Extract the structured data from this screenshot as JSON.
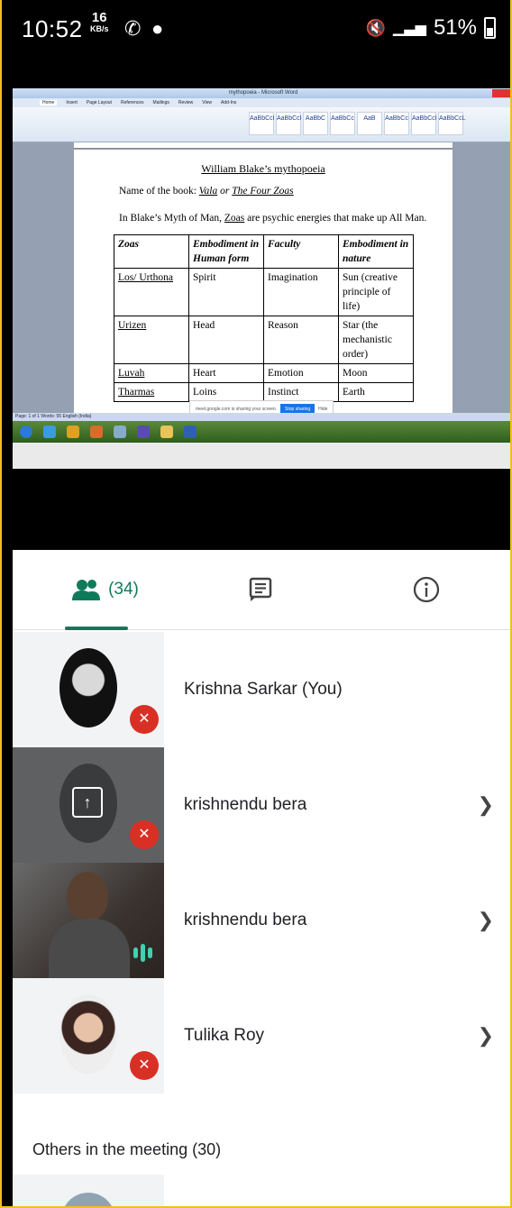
{
  "status": {
    "time": "10:52",
    "kbs_value": "16",
    "kbs_unit": "KB/s",
    "battery": "51%"
  },
  "word": {
    "window_title": "mythopoeia - Microsoft Word",
    "menus": [
      "Home",
      "Insert",
      "Page Layout",
      "References",
      "Mailings",
      "Review",
      "View",
      "Add-Ins"
    ],
    "styles": [
      "AaBbCcI",
      "AaBbCcI",
      "AaBbC",
      "AaBbCc",
      "AaB",
      "AaBbCc",
      "AaBbCcI",
      "AaBbCcL"
    ],
    "doc_title": "William Blake’s mythopoeia",
    "book_line_prefix": "Name of the book: ",
    "book_title_a": "Vala",
    "book_title_or": " or ",
    "book_title_b": "The Four Zoas",
    "myth_line_a": "In Blake’s Myth of Man, ",
    "myth_line_zoas": "Zoas",
    "myth_line_b": " are psychic energies that make up All Man.",
    "table": {
      "headers": [
        "Zoas",
        "Embodiment in Human form",
        "Faculty",
        "Embodiment in nature"
      ],
      "rows": [
        [
          "Los/ Urthona",
          "Spirit",
          "Imagination",
          "Sun (creative principle of life)"
        ],
        [
          "Urizen",
          "Head",
          "Reason",
          "Star (the mechanistic order)"
        ],
        [
          "Luvah",
          "Heart",
          "Emotion",
          "Moon"
        ],
        [
          "Tharmas",
          "Loins",
          "Instinct",
          "Earth"
        ]
      ]
    },
    "share_notice": "meet.google.com is sharing your screen.",
    "stop_sharing": "Stop sharing",
    "hide": "Hide",
    "statusbar": "Page: 1 of 1   Words: 55   English (India)"
  },
  "tabs": {
    "people_count": "(34)"
  },
  "participants": [
    {
      "name": "Krishna Sarkar (You)"
    },
    {
      "name": "krishnendu bera"
    },
    {
      "name": "krishnendu bera"
    },
    {
      "name": "Tulika Roy"
    }
  ],
  "others_label": "Others in the meeting (30)",
  "colors": {
    "accent": "#0f7a5a",
    "mute_red": "#d93025",
    "frame": "#f2c01e"
  }
}
